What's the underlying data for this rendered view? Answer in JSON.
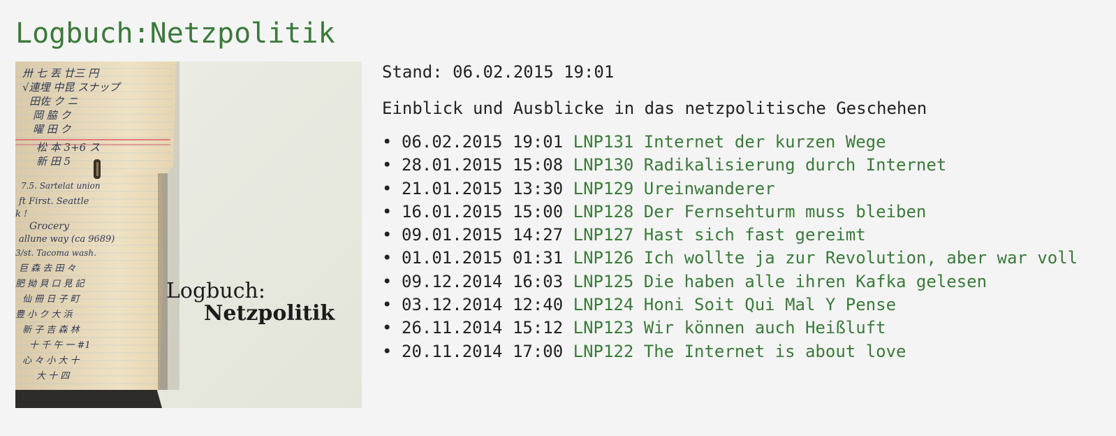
{
  "page": {
    "title": "Logbuch:Netzpolitik"
  },
  "cover": {
    "logo_line1": "Logbuch:",
    "logo_line2": "Netzpolitik"
  },
  "info": {
    "stand": "Stand: 06.02.2015 19:01",
    "description": "Einblick und Ausblicke in das netzpolitische Geschehen"
  },
  "episodes": [
    {
      "date": "06.02.2015 19:01",
      "link": "LNP131 Internet der kurzen Wege"
    },
    {
      "date": "28.01.2015 15:08",
      "link": "LNP130 Radikalisierung durch Internet"
    },
    {
      "date": "21.01.2015 13:30",
      "link": "LNP129 Ureinwanderer"
    },
    {
      "date": "16.01.2015 15:00",
      "link": "LNP128 Der Fernsehturm muss bleiben"
    },
    {
      "date": "09.01.2015 14:27",
      "link": "LNP127 Hast sich fast gereimt"
    },
    {
      "date": "01.01.2015 01:31",
      "link": "LNP126 Ich wollte ja zur Revolution, aber war voll"
    },
    {
      "date": "09.12.2014 16:03",
      "link": "LNP125 Die haben alle ihren Kafka gelesen"
    },
    {
      "date": "03.12.2014 12:40",
      "link": "LNP124 Honi Soit Qui Mal Y Pense"
    },
    {
      "date": "26.11.2014 15:12",
      "link": "LNP123 Wir können auch Heißluft"
    },
    {
      "date": "20.11.2014 17:00",
      "link": "LNP122 The Internet is about love"
    }
  ],
  "colors": {
    "link": "#3b7a3b",
    "background": "#f4f4f4",
    "text": "#222222"
  }
}
